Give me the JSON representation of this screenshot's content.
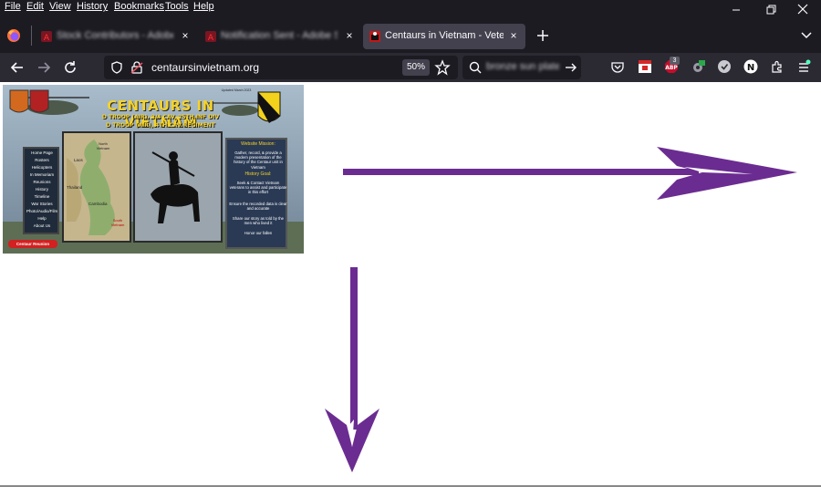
{
  "menubar": {
    "items": [
      "File",
      "Edit",
      "View",
      "History",
      "Bookmarks",
      "Tools",
      "Help"
    ]
  },
  "tabs": [
    {
      "title": "Stock Contributors - Adobe Stock",
      "active": false,
      "blurred": true
    },
    {
      "title": "Notification Sent - Adobe Support",
      "active": false,
      "blurred": true
    },
    {
      "title": "Centaurs in Vietnam - Veterans",
      "active": true,
      "blurred": false
    }
  ],
  "navbar": {
    "url": "centaursinvietnam.org",
    "zoom": "50%",
    "search_text": "bronze sun plate",
    "abp_badge": "3"
  },
  "banner": {
    "title": "CENTAURS IN VIETNAM",
    "subtitle_1": "D TROOP (AIR), 3/4 CAV, 25TH INF DIV",
    "subtitle_2": "D TROOP (AIR), 4TH CAV REGIMENT",
    "update_note": "Updated March 2023",
    "menu": [
      "Home Page",
      "Rosters",
      "Helicopters",
      "In Memoriam",
      "Reunions",
      "History",
      "Timeline",
      "War Stories",
      "Photo/Audio/Film",
      "Help",
      "About Us"
    ],
    "reunion_button": "Centaur Reunion",
    "map_labels": [
      "North Vietnam",
      "Laos",
      "Thailand",
      "Cambodia",
      "South Vietnam"
    ],
    "mission_title": "Website Mission:",
    "mission_lines": [
      "Gather, record, & provide a modern presentation of the history of the Centaur unit in Vietnam"
    ],
    "history_title": "History Goal:",
    "history_lines": [
      "Seek & Contact Vietnam veterans to assist and participate in this effort",
      "Ensure the recorded data is clear and accurate",
      "Share our story as told by the men who lived it",
      "Honor our fallen"
    ]
  },
  "colors": {
    "chrome_bg": "#1c1b22",
    "toolbar_bg": "#2b2a33",
    "active_tab": "#42414d",
    "arrow": "#6b2c91"
  }
}
